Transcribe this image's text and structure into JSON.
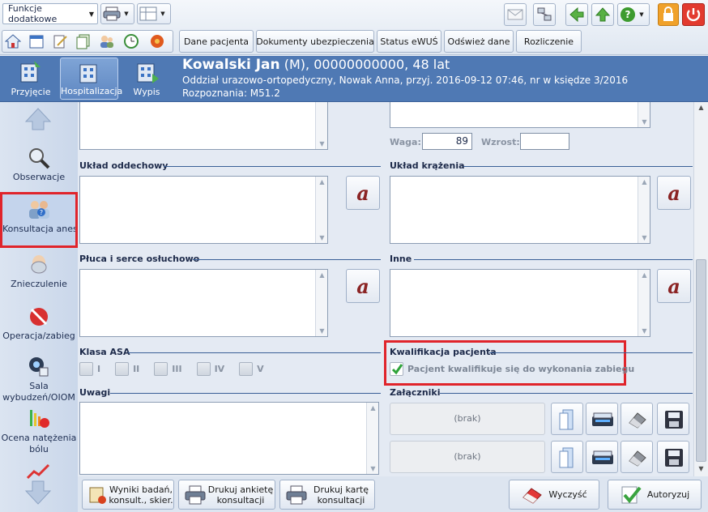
{
  "toolbar": {
    "combo_label": "Funkcje dodatkowe",
    "tabs": [
      "Dane pacjenta",
      "Dokumenty ubezpieczenia",
      "Status eWUŚ",
      "Odśwież dane",
      "Rozliczenie"
    ]
  },
  "nav": {
    "items": [
      {
        "label": "Przyjęcie",
        "active": false
      },
      {
        "label": "Hospitalizacja",
        "active": true
      },
      {
        "label": "Wypis",
        "active": false
      }
    ]
  },
  "patient": {
    "name": "Kowalski Jan",
    "rest": " (M), 00000000000, 48 lat",
    "line1": "Oddział urazowo-ortopedyczny, Nowak Anna, przyj. 2016-09-12 07:46, nr w księdze 3/2016",
    "line2": "Rozpoznania: M51.2"
  },
  "sidebar": {
    "items": [
      {
        "label": "Obserwacje"
      },
      {
        "label": "Konsultacja anestezjologiczna",
        "selected": true
      },
      {
        "label": "Znieczulenie"
      },
      {
        "label": "Operacja/zabieg"
      },
      {
        "label": "Sala wybudzeń/OIOM"
      },
      {
        "label": "Ocena natężenia bólu"
      }
    ]
  },
  "form": {
    "waga_label": "Waga:",
    "waga_value": "89",
    "wzrost_label": "Wzrost:",
    "wzrost_value": "",
    "uklad_oddechowy": "Układ oddechowy",
    "uklad_krazenia": "Układ krążenia",
    "pluca": "Płuca i serce osłuchowo",
    "inne": "Inne",
    "klasa_asa": "Klasa ASA",
    "asa_options": [
      "I",
      "II",
      "III",
      "IV",
      "V"
    ],
    "kwalifikacja": "Kwalifikacja pacjenta",
    "kwalifikacja_check": "Pacjent kwalifikuje się do wykonania zabiegu",
    "uwagi": "Uwagi",
    "zalaczniki": "Załączniki",
    "brak": "(brak)"
  },
  "bottom": {
    "wyniki": "Wyniki badań, konsult., skier.",
    "drukuj_ankiete": "Drukuj ankietę konsultacji",
    "drukuj_karte": "Drukuj kartę konsultacji",
    "wyczysc": "Wyczyść",
    "autoryzuj": "Autoryzuj"
  },
  "colors": {
    "header": "#4f79b4",
    "highlight": "#e0242b",
    "section_line": "#3a5f96"
  }
}
